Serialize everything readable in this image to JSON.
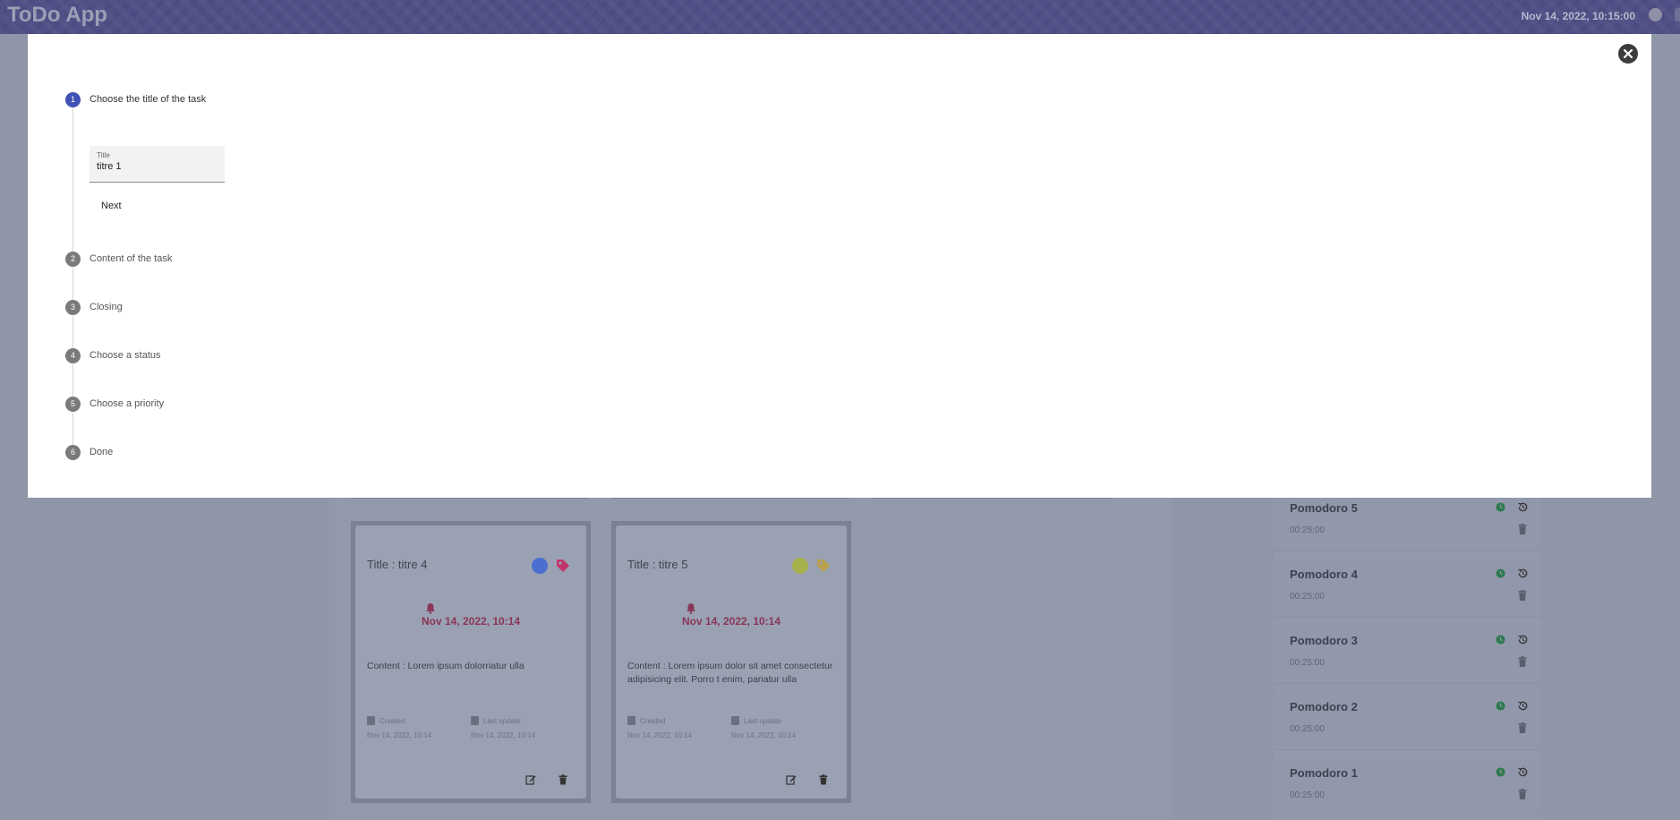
{
  "app": {
    "title": "ToDo App",
    "datetime": "Nov 14, 2022, 10:15:00"
  },
  "modal": {
    "close_icon": "close-icon",
    "title_field": {
      "label": "Title",
      "value": "titre 1"
    },
    "next_label": "Next",
    "steps": [
      {
        "number": "1",
        "label": "Choose the title of the task",
        "state": "active"
      },
      {
        "number": "2",
        "label": "Content of the task",
        "state": "inactive"
      },
      {
        "number": "3",
        "label": "Closing",
        "state": "inactive"
      },
      {
        "number": "4",
        "label": "Choose a status",
        "state": "inactive"
      },
      {
        "number": "5",
        "label": "Choose a priority",
        "state": "inactive"
      },
      {
        "number": "6",
        "label": "Done",
        "state": "inactive"
      }
    ],
    "colors": {
      "active_step": "#3f51b5",
      "inactive_step": "#7a7a7a"
    }
  },
  "cards": [
    {
      "title": "Title : titre 4",
      "status_color": "#4a6fd0",
      "tag_color": "#c0356b",
      "due": "Nov 14, 2022, 10:14",
      "content": "Content : Lorem ipsum dolorriatur ulla",
      "created_label": "Created",
      "created_value": "Nov 14, 2022, 10:14",
      "updated_label": "Last update",
      "updated_value": "Nov 14, 2022, 10:14"
    },
    {
      "title": "Title : titre 5",
      "status_color": "#a8b24d",
      "tag_color": "#b8a14a",
      "due": "Nov 14, 2022, 10:14",
      "content": "Content : Lorem ipsum dolor sit amet consectetur adipisicing elit. Porro t enim, pariatur ulla",
      "created_label": "Created",
      "created_value": "Nov 14, 2022, 10:14",
      "updated_label": "Last update",
      "updated_value": "Nov 14, 2022, 10:14"
    }
  ],
  "pomodoros": [
    {
      "name": "Pomodoro 5",
      "time": "00:25:00"
    },
    {
      "name": "Pomodoro 4",
      "time": "00:25:00"
    },
    {
      "name": "Pomodoro 3",
      "time": "00:25:00"
    },
    {
      "name": "Pomodoro 2",
      "time": "00:25:00"
    },
    {
      "name": "Pomodoro 1",
      "time": "00:25:00"
    }
  ]
}
